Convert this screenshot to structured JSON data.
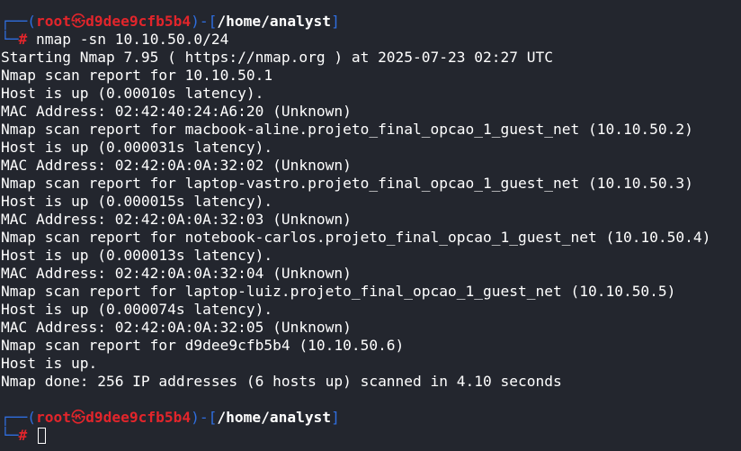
{
  "prompt1": {
    "corner_top": "┌──(",
    "user": "root",
    "at_symbol": "㉿",
    "host": "d9dee9cfb5b4",
    "sep": ")-[",
    "path": "/home/analyst",
    "close": "]",
    "corner_bottom": "└─",
    "hash": "#",
    "command": " nmap -sn 10.10.50.0/24"
  },
  "output": [
    "Starting Nmap 7.95 ( https://nmap.org ) at 2025-07-23 02:27 UTC",
    "Nmap scan report for 10.10.50.1",
    "Host is up (0.00010s latency).",
    "MAC Address: 02:42:40:24:A6:20 (Unknown)",
    "Nmap scan report for macbook-aline.projeto_final_opcao_1_guest_net (10.10.50.2)",
    "Host is up (0.000031s latency).",
    "MAC Address: 02:42:0A:0A:32:02 (Unknown)",
    "Nmap scan report for laptop-vastro.projeto_final_opcao_1_guest_net (10.10.50.3)",
    "Host is up (0.000015s latency).",
    "MAC Address: 02:42:0A:0A:32:03 (Unknown)",
    "Nmap scan report for notebook-carlos.projeto_final_opcao_1_guest_net (10.10.50.4)",
    "Host is up (0.000013s latency).",
    "MAC Address: 02:42:0A:0A:32:04 (Unknown)",
    "Nmap scan report for laptop-luiz.projeto_final_opcao_1_guest_net (10.10.50.5)",
    "Host is up (0.000074s latency).",
    "MAC Address: 02:42:0A:0A:32:05 (Unknown)",
    "Nmap scan report for d9dee9cfb5b4 (10.10.50.6)",
    "Host is up.",
    "Nmap done: 256 IP addresses (6 hosts up) scanned in 4.10 seconds"
  ],
  "prompt2": {
    "corner_top": "┌──(",
    "user": "root",
    "at_symbol": "㉿",
    "host": "d9dee9cfb5b4",
    "sep": ")-[",
    "path": "/home/analyst",
    "close": "]",
    "corner_bottom": "└─",
    "hash": "#"
  },
  "colors": {
    "background": "#23262e",
    "frame": "#2f6ee0",
    "user_host": "#e2252b",
    "text": "#ffffff"
  }
}
